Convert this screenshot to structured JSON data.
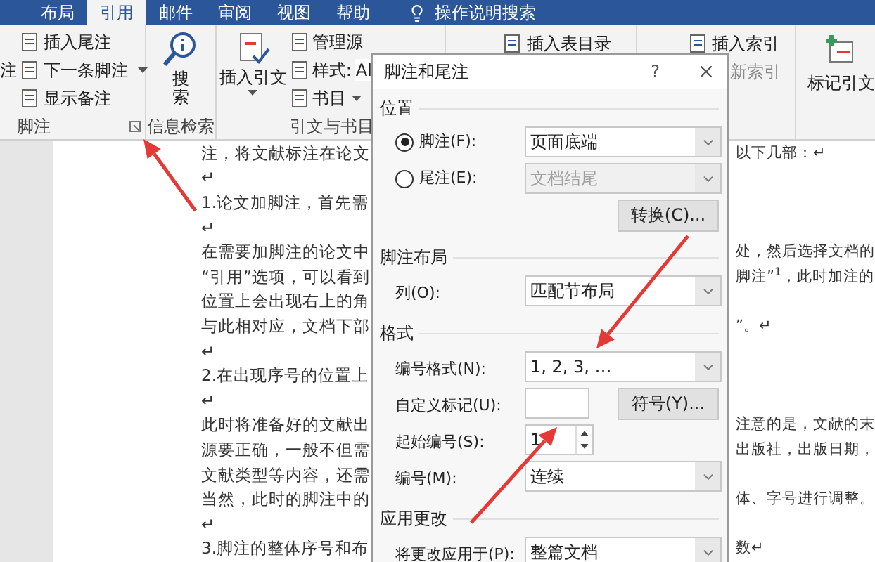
{
  "ribbon_tabs": [
    {
      "label": "布局",
      "selected": false
    },
    {
      "label": "引用",
      "selected": true
    },
    {
      "label": "邮件",
      "selected": false
    },
    {
      "label": "审阅",
      "selected": false
    },
    {
      "label": "视图",
      "selected": false
    },
    {
      "label": "帮助",
      "selected": false
    }
  ],
  "tell_me": "操作说明搜索",
  "ribbon": {
    "footnotes": {
      "partial": "注",
      "items": [
        {
          "label": "插入尾注",
          "dropdown": false
        },
        {
          "label": "下一条脚注",
          "dropdown": true
        },
        {
          "label": "显示备注",
          "dropdown": false
        }
      ],
      "title": "脚注"
    },
    "research": {
      "button": "搜索",
      "title": "信息检索"
    },
    "citations": {
      "button": "插入引文",
      "items": [
        {
          "label": "管理源"
        },
        {
          "label": "样式:",
          "value": "Al"
        },
        {
          "label": "书目",
          "dropdown": true
        }
      ],
      "title": "引文与书目"
    },
    "captions": {
      "item": "插入表目录"
    },
    "index": {
      "items": [
        {
          "label": "插入索引",
          "disabled": false
        },
        {
          "label": "新索引",
          "disabled": true
        }
      ]
    },
    "authorities": {
      "button": "标记引文"
    }
  },
  "document": {
    "lines": [
      {
        "left": "注，将文献标注在论文",
        "right": "以下几部：↵"
      },
      {
        "left": "↵"
      },
      {
        "left": "1.论文加脚注，首先需"
      },
      {
        "left": "↵"
      },
      {
        "left": "在需要加脚注的论文中",
        "right": "处，然后选择文档的"
      },
      {
        "left": "“引用”选项，可以看到",
        "right": "脚注”$^{1}$，此时加注的"
      },
      {
        "left": "位置上会出现右上的角"
      },
      {
        "left": "与此相对应，文档下部",
        "right": "”。↵"
      },
      {
        "left": "↵"
      },
      {
        "left": "2.在出现序号的位置上"
      },
      {
        "left": "↵"
      },
      {
        "left": "此时将准备好的文献出",
        "right": "注意的是，文献的末"
      },
      {
        "left": "源要正确，一般不但需",
        "right": "出版社，出版日期，"
      },
      {
        "left": "文献类型等内容，还需"
      },
      {
        "left": "当然，此时的脚注中的",
        "right": "体、字号进行调整。"
      },
      {
        "left": "↵"
      },
      {
        "left": "3.脚注的整体序号和布",
        "right": "数↵"
      }
    ]
  },
  "dialog": {
    "title": "脚注和尾注",
    "help": "?",
    "sections": [
      {
        "title": "位置",
        "rows": [
          {
            "kind": "radio",
            "label": "脚注(F):",
            "selected": true,
            "value": "页面底端",
            "disabled": false
          },
          {
            "kind": "radio",
            "label": "尾注(E):",
            "selected": false,
            "value": "文档结尾",
            "disabled": true
          },
          {
            "kind": "button",
            "label": "转换(C)..."
          }
        ]
      },
      {
        "title": "脚注布局",
        "rows": [
          {
            "kind": "select",
            "label": "列(O):",
            "value": "匹配节布局"
          }
        ]
      },
      {
        "title": "格式",
        "rows": [
          {
            "kind": "select",
            "label": "编号格式(N):",
            "value": "1, 2, 3, …"
          },
          {
            "kind": "input_button",
            "label": "自定义标记(U):",
            "button": "符号(Y)..."
          },
          {
            "kind": "spinner",
            "label": "起始编号(S):",
            "value": "1"
          },
          {
            "kind": "select",
            "label": "编号(M):",
            "value": "连续"
          }
        ]
      },
      {
        "title": "应用更改",
        "rows": [
          {
            "kind": "select",
            "label": "将更改应用于(P):",
            "value": "整篇文档"
          }
        ]
      }
    ]
  }
}
